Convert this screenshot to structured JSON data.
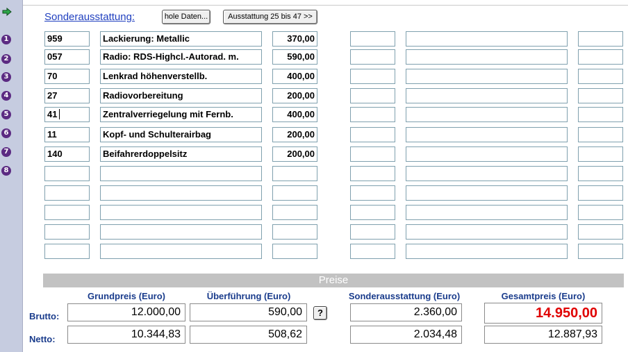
{
  "header": {
    "link_label": "Sonderausstattung:",
    "fetch_button": "hole Daten...",
    "next_button": "Ausstattung 25 bis 47 >>"
  },
  "sidebar": {
    "arrow_icon": "green-arrow-right-icon",
    "row_numbers": [
      "1",
      "2",
      "3",
      "4",
      "5",
      "6",
      "7",
      "8"
    ]
  },
  "equipment_left": [
    {
      "code": "959",
      "description": "Lackierung: Metallic",
      "price": "370,00"
    },
    {
      "code": "057",
      "description": "Radio: RDS-Highcl.-Autorad. m.",
      "price": "590,00"
    },
    {
      "code": "70",
      "description": "Lenkrad höhenverstellb.",
      "price": "400,00"
    },
    {
      "code": "27",
      "description": "Radiovorbereitung",
      "price": "200,00"
    },
    {
      "code": "41",
      "description": "Zentralverriegelung mit Fernb.",
      "price": "400,00"
    },
    {
      "code": "11",
      "description": "Kopf- und Schulterairbag",
      "price": "200,00"
    },
    {
      "code": "140",
      "description": "Beifahrerdoppelsitz",
      "price": "200,00"
    },
    {
      "code": "",
      "description": "",
      "price": ""
    },
    {
      "code": "",
      "description": "",
      "price": ""
    },
    {
      "code": "",
      "description": "",
      "price": ""
    },
    {
      "code": "",
      "description": "",
      "price": ""
    },
    {
      "code": "",
      "description": "",
      "price": ""
    }
  ],
  "equipment_right": [
    {
      "code": "",
      "description": "",
      "price": ""
    },
    {
      "code": "",
      "description": "",
      "price": ""
    },
    {
      "code": "",
      "description": "",
      "price": ""
    },
    {
      "code": "",
      "description": "",
      "price": ""
    },
    {
      "code": "",
      "description": "",
      "price": ""
    },
    {
      "code": "",
      "description": "",
      "price": ""
    },
    {
      "code": "",
      "description": "",
      "price": ""
    },
    {
      "code": "",
      "description": "",
      "price": ""
    },
    {
      "code": "",
      "description": "",
      "price": ""
    },
    {
      "code": "",
      "description": "",
      "price": ""
    },
    {
      "code": "",
      "description": "",
      "price": ""
    },
    {
      "code": "",
      "description": "",
      "price": ""
    }
  ],
  "prices": {
    "band_title": "Preise",
    "headers": {
      "grundpreis": "Grundpreis (Euro)",
      "ueberfuehrung": "Überführung (Euro)",
      "sonderausstattung": "Sonderausstattung (Euro)",
      "gesamtpreis": "Gesamtpreis (Euro)"
    },
    "brutto_label": "Brutto:",
    "netto_label": "Netto:",
    "help_button": "?",
    "brutto": {
      "grundpreis": "12.000,00",
      "ueberfuehrung": "590,00",
      "sonderausstattung": "2.360,00",
      "gesamtpreis": "14.950,00"
    },
    "netto": {
      "grundpreis": "10.344,83",
      "ueberfuehrung": "508,62",
      "sonderausstattung": "2.034,48",
      "gesamtpreis": "12.887,93"
    },
    "accent_color": "#e00000"
  }
}
